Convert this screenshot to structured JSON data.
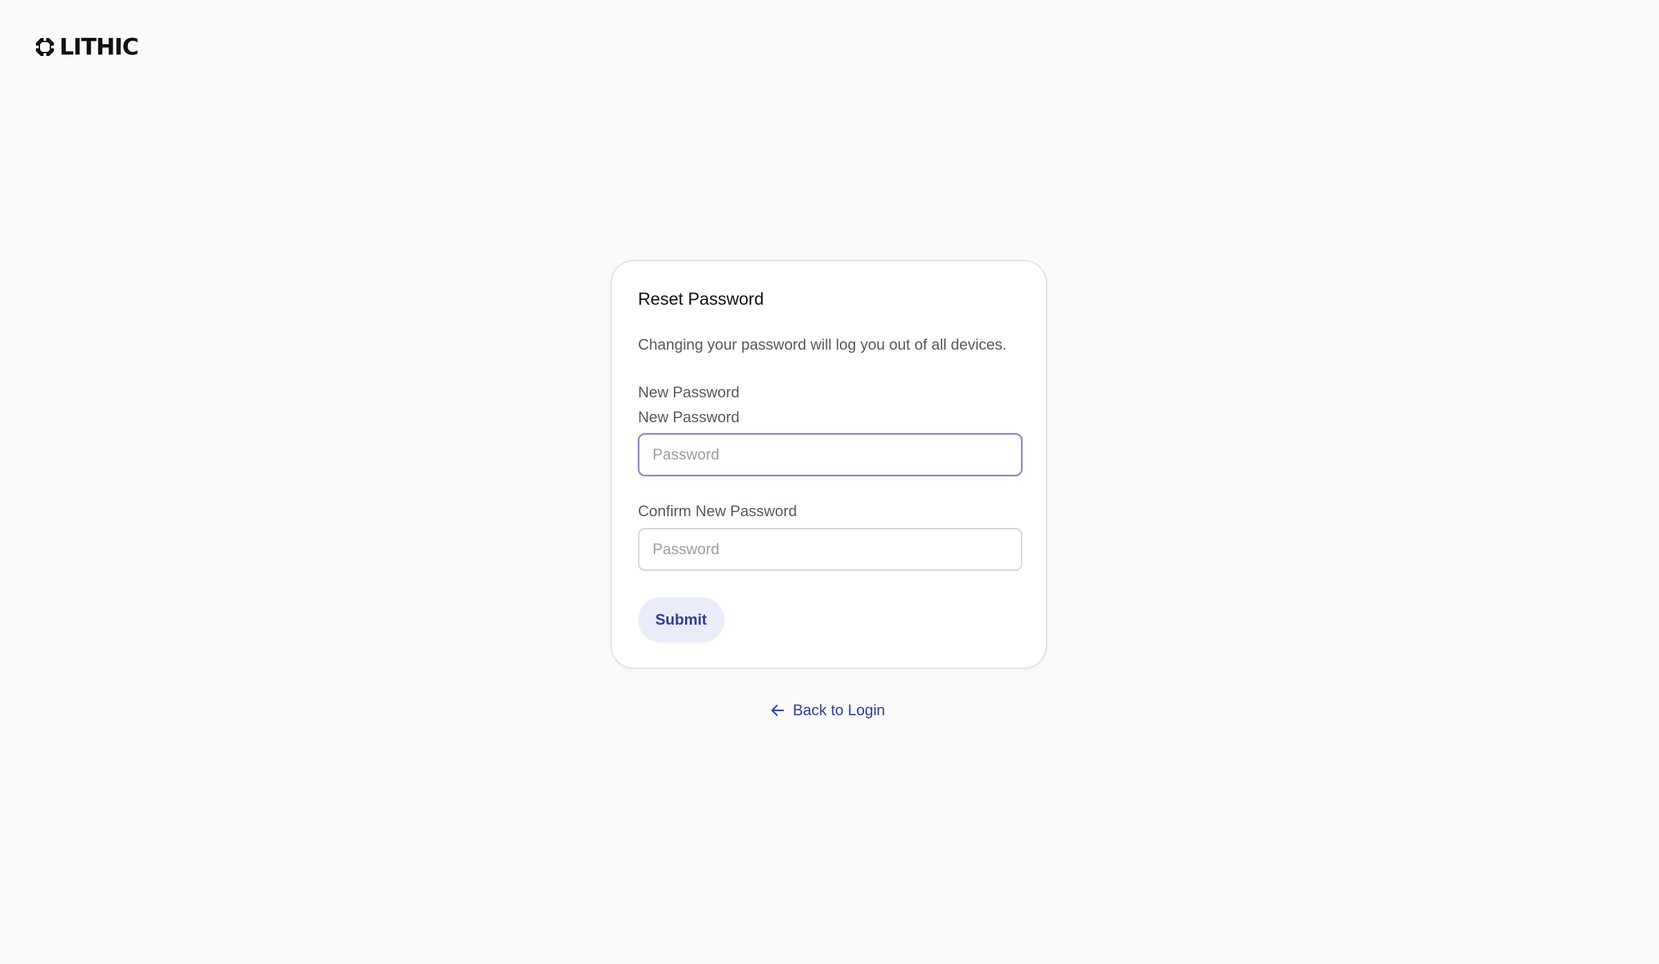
{
  "brand": {
    "logo_icon": "lithic-logo-icon",
    "name": "LITHIC"
  },
  "card": {
    "title": "Reset Password",
    "description": "Changing your password will log you out of all devices.",
    "section_label": "New Password",
    "new_password": {
      "label": "New Password",
      "placeholder": "Password",
      "value": ""
    },
    "confirm_password": {
      "label": "Confirm New Password",
      "placeholder": "Password",
      "value": ""
    },
    "submit_label": "Submit"
  },
  "back_link": {
    "icon": "arrow-left-icon",
    "label": "Back to Login"
  },
  "colors": {
    "background": "#fafafa",
    "accent": "#2f3d99",
    "button_bg": "#ebecf9",
    "focus_border": "#7f86bf"
  }
}
